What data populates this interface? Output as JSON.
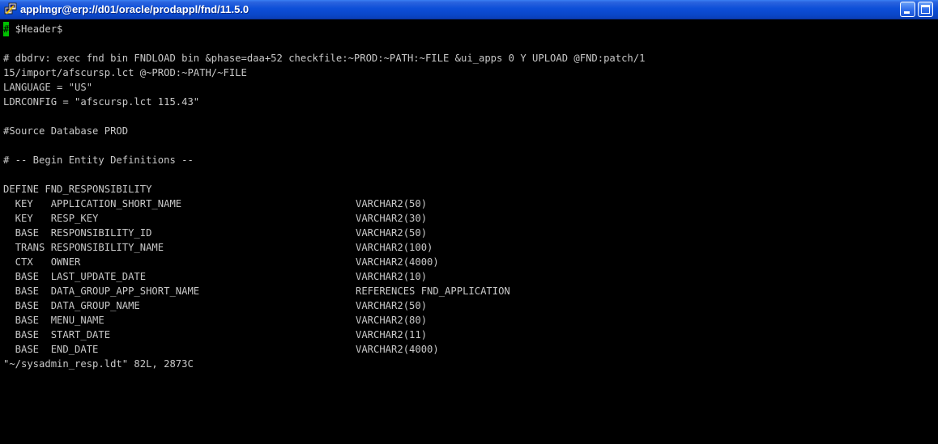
{
  "window": {
    "title": "applmgr@erp://d01/oracle/prodappl/fnd/11.5.0",
    "icon": "putty-icon",
    "controls": [
      "minimize-icon",
      "maximize-icon"
    ]
  },
  "terminal": {
    "cursor_char": "#",
    "header_line": " $Header$",
    "lines": [
      "",
      "# dbdrv: exec fnd bin FNDLOAD bin &phase=daa+52 checkfile:~PROD:~PATH:~FILE &ui_apps 0 Y UPLOAD @FND:patch/1",
      "15/import/afscursp.lct @~PROD:~PATH/~FILE",
      "LANGUAGE = \"US\"",
      "LDRCONFIG = \"afscursp.lct 115.43\"",
      "",
      "#Source Database PROD",
      "",
      "# -- Begin Entity Definitions --",
      "",
      "DEFINE FND_RESPONSIBILITY"
    ],
    "definitions": [
      {
        "field": "  KEY   APPLICATION_SHORT_NAME",
        "type": "VARCHAR2(50)"
      },
      {
        "field": "  KEY   RESP_KEY",
        "type": "VARCHAR2(30)"
      },
      {
        "field": "  BASE  RESPONSIBILITY_ID",
        "type": "VARCHAR2(50)"
      },
      {
        "field": "  TRANS RESPONSIBILITY_NAME",
        "type": "VARCHAR2(100)"
      },
      {
        "field": "  CTX   OWNER",
        "type": "VARCHAR2(4000)"
      },
      {
        "field": "  BASE  LAST_UPDATE_DATE",
        "type": "VARCHAR2(10)"
      },
      {
        "field": "  BASE  DATA_GROUP_APP_SHORT_NAME",
        "type": "REFERENCES FND_APPLICATION"
      },
      {
        "field": "  BASE  DATA_GROUP_NAME",
        "type": "VARCHAR2(50)"
      },
      {
        "field": "  BASE  MENU_NAME",
        "type": "VARCHAR2(80)"
      },
      {
        "field": "  BASE  START_DATE",
        "type": "VARCHAR2(11)"
      },
      {
        "field": "  BASE  END_DATE",
        "type": "VARCHAR2(4000)"
      }
    ],
    "status_line": "\"~/sysadmin_resp.ldt\" 82L, 2873C",
    "colors": {
      "background": "#000000",
      "foreground": "#c8c8c8",
      "cursor": "#00c000",
      "titlebar": "#0d4fd8"
    }
  }
}
